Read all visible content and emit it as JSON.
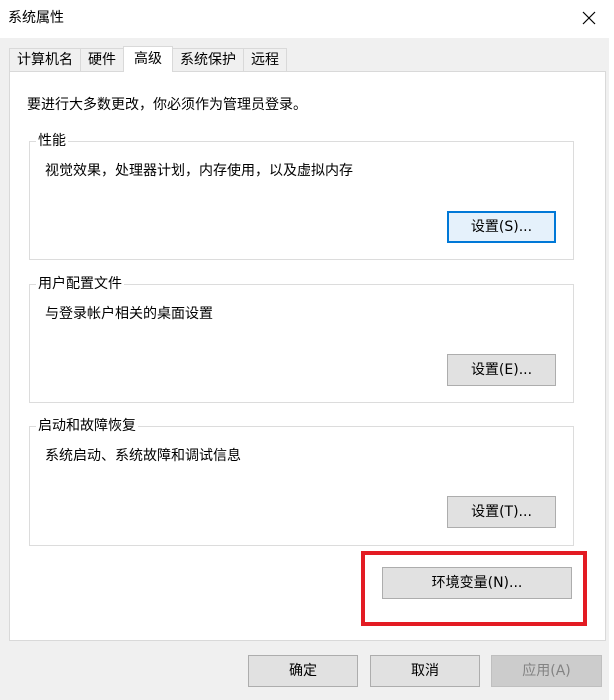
{
  "window": {
    "title": "系统属性",
    "close_icon": "close-icon"
  },
  "tabs": [
    {
      "label": "计算机名",
      "active": false
    },
    {
      "label": "硬件",
      "active": false
    },
    {
      "label": "高级",
      "active": true
    },
    {
      "label": "系统保护",
      "active": false
    },
    {
      "label": "远程",
      "active": false
    }
  ],
  "advanced": {
    "admin_note": "要进行大多数更改，你必须作为管理员登录。",
    "performance": {
      "title": "性能",
      "description": "视觉效果，处理器计划，内存使用，以及虚拟内存",
      "button": "设置(S)..."
    },
    "user_profiles": {
      "title": "用户配置文件",
      "description": "与登录帐户相关的桌面设置",
      "button": "设置(E)..."
    },
    "startup_recovery": {
      "title": "启动和故障恢复",
      "description": "系统启动、系统故障和调试信息",
      "button": "设置(T)..."
    },
    "env_vars_button": "环境变量(N)..."
  },
  "footer": {
    "ok": "确定",
    "cancel": "取消",
    "apply": "应用(A)"
  },
  "colors": {
    "focus_border": "#0078d7",
    "highlight": "#e31b23",
    "panel_bg": "#ffffff",
    "dialog_bg": "#f0f0f0"
  }
}
